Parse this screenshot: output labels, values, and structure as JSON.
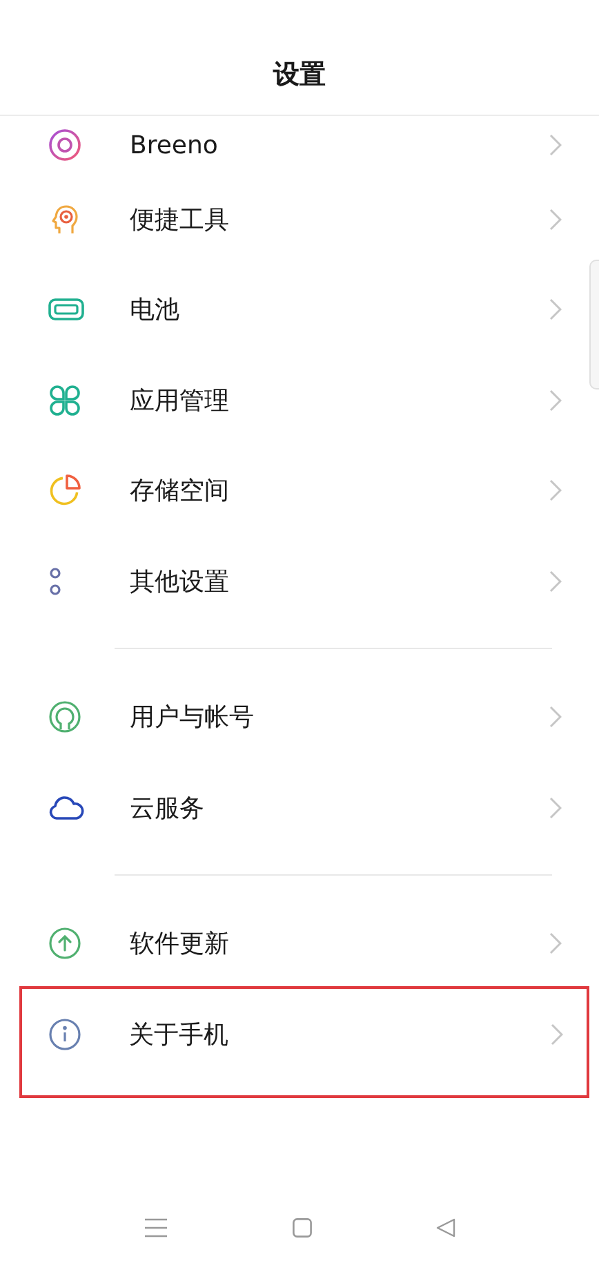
{
  "header": {
    "title": "设置"
  },
  "groups": [
    {
      "items": [
        {
          "label": "Breeno",
          "kind": "ring",
          "highlighted": false
        },
        {
          "label": "便捷工具",
          "kind": "head",
          "highlighted": false
        },
        {
          "label": "电池",
          "kind": "battery",
          "highlighted": false
        },
        {
          "label": "应用管理",
          "kind": "apps",
          "highlighted": false
        },
        {
          "label": "存储空间",
          "kind": "pie",
          "highlighted": false
        },
        {
          "label": "其他设置",
          "kind": "dots",
          "highlighted": false
        }
      ]
    },
    {
      "items": [
        {
          "label": "用户与帐号",
          "kind": "user",
          "highlighted": false
        },
        {
          "label": "云服务",
          "kind": "cloud",
          "highlighted": false
        }
      ]
    },
    {
      "items": [
        {
          "label": "软件更新",
          "kind": "update",
          "highlighted": false
        },
        {
          "label": "关于手机",
          "kind": "info",
          "highlighted": true
        }
      ]
    }
  ]
}
